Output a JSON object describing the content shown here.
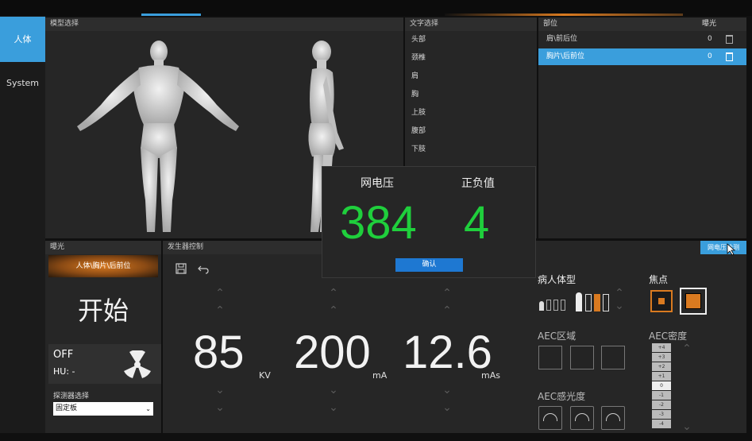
{
  "nav": {
    "items": [
      "人体",
      "System"
    ]
  },
  "model_panel": {
    "title": "模型选择"
  },
  "text_panel": {
    "title": "文字选择",
    "items": [
      "头部",
      "颈椎",
      "肩",
      "胸",
      "上肢",
      "腹部",
      "下肢"
    ]
  },
  "position_panel": {
    "col_position": "部位",
    "col_exposure": "曝光",
    "rows": [
      {
        "label": "肩\\前后位",
        "count": "0"
      },
      {
        "label": "胸片\\后前位",
        "count": "0"
      }
    ]
  },
  "exposure_panel": {
    "title": "曝光",
    "selected": "人体\\胸片\\后前位",
    "start": "开始",
    "status": "OFF",
    "hu": "HU: -",
    "detector_label": "探测器选择",
    "detector_value": "固定板"
  },
  "generator": {
    "title": "发生器控制",
    "kv": {
      "value": "85",
      "unit": "KV"
    },
    "ma": {
      "value": "200",
      "unit": "mA"
    },
    "mas": {
      "value": "12.6",
      "unit": "mAs"
    }
  },
  "dialog": {
    "label_voltage": "网电压",
    "label_polarity": "正负值",
    "voltage_value": "384",
    "polarity_value": "4",
    "confirm": "确认"
  },
  "right_panel": {
    "net_voltage_button": "网电压检测",
    "body_type_label": "病人体型",
    "focus_label": "焦点",
    "aec_area_label": "AEC区域",
    "aec_density_label": "AEC密度",
    "aec_sensitivity_label": "AEC感光度",
    "density_levels": [
      "+4",
      "+3",
      "+2",
      "+1",
      "0",
      "-1",
      "-2",
      "-3",
      "-4"
    ]
  },
  "colors": {
    "accent": "#3a9edc",
    "green": "#1fcf3c",
    "orange": "#d97a20"
  }
}
